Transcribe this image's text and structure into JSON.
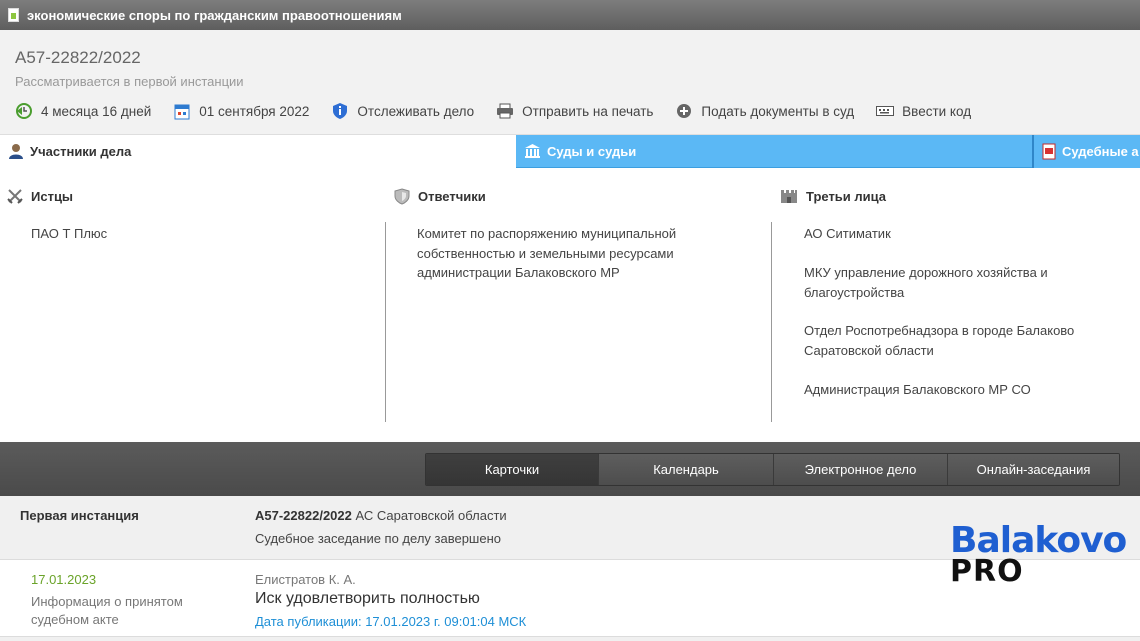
{
  "window": {
    "title": "экономические споры по гражданским правоотношениям"
  },
  "case": {
    "number": "А57-22822/2022",
    "status": "Рассматривается в первой инстанции",
    "actions": [
      {
        "icon": "clock-back-icon",
        "label": "4 месяца 16 дней"
      },
      {
        "icon": "calendar-icon",
        "label": "01 сентября 2022"
      },
      {
        "icon": "shield-info-icon",
        "label": "Отслеживать дело"
      },
      {
        "icon": "printer-icon",
        "label": "Отправить на печать"
      },
      {
        "icon": "plus-circle-icon",
        "label": "Подать документы в суд"
      },
      {
        "icon": "keyboard-icon",
        "label": "Ввести код"
      }
    ]
  },
  "tabs": {
    "participants": "Участники дела",
    "courts": "Суды и судьи",
    "acts": "Судебные а"
  },
  "participants": {
    "plaintiffs": {
      "title": "Истцы",
      "items": [
        "ПАО Т Плюс"
      ]
    },
    "defendants": {
      "title": "Ответчики",
      "items": [
        "Комитет по распоряжению муниципальной",
        "собственностью и земельными ресурсами",
        "администрации Балаковского МР"
      ]
    },
    "third_parties": {
      "title": "Третьи лица",
      "items": [
        [
          "АО Ситиматик"
        ],
        [
          "МКУ управление дорожного хозяйства и",
          "благоустройства"
        ],
        [
          "Отдел Роспотребнадзора в городе Балаково",
          "Саратовской области"
        ],
        [
          "Администрация Балаковского МР СО"
        ]
      ]
    }
  },
  "nav": {
    "items": [
      "Карточки",
      "Календарь",
      "Электронное дело",
      "Онлайн-заседания"
    ]
  },
  "instance": {
    "label": "Первая инстанция",
    "case_number": "А57-22822/2022",
    "court": "АС Саратовской области",
    "status": "Судебное заседание по делу завершено"
  },
  "event": {
    "date": "17.01.2023",
    "type_line1": "Информация о принятом",
    "type_line2": "судебном акте",
    "judge": "Елистратов К. А.",
    "result": "Иск удовлетворить полностью",
    "publication": "Дата публикации: 17.01.2023 г. 09:01:04 МСК"
  },
  "logo": {
    "line1": "Balakovo",
    "line2": "PRO"
  },
  "colors": {
    "tab_blue": "#5bb8f5",
    "date_green": "#6aa329",
    "link_blue": "#1e8fd6"
  }
}
